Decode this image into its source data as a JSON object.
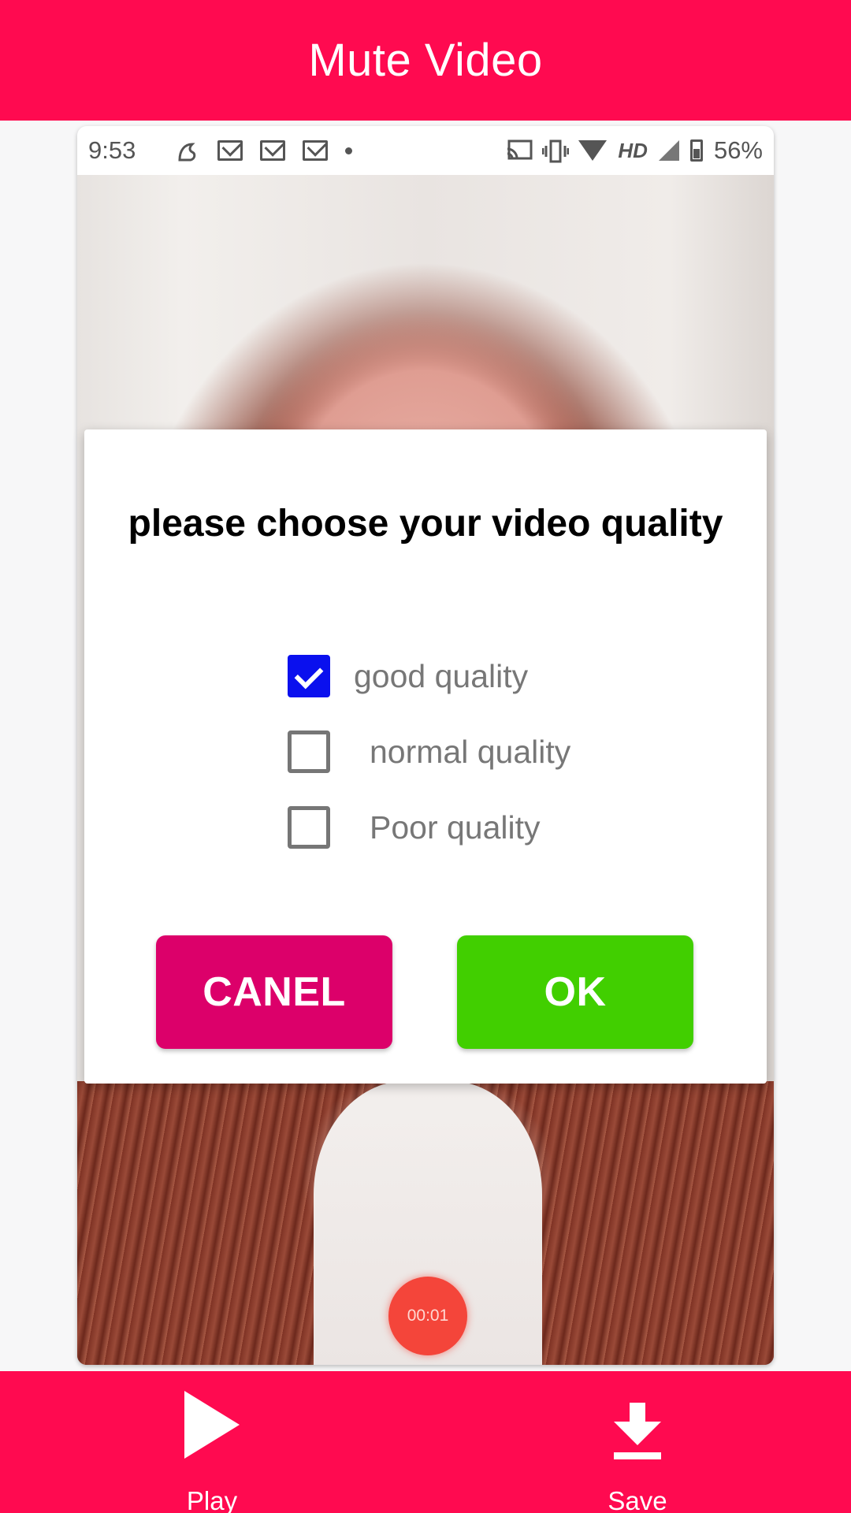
{
  "app_bar": {
    "title": "Mute Video"
  },
  "status_bar": {
    "time": "9:53",
    "network_label": "HD",
    "battery": "56%"
  },
  "video": {
    "timer": "00:01"
  },
  "dialog": {
    "title": "please choose your video quality",
    "options": [
      {
        "label": "good quality",
        "checked": true
      },
      {
        "label": "normal quality",
        "checked": false
      },
      {
        "label": "Poor quality",
        "checked": false
      }
    ],
    "cancel_label": "CANEL",
    "ok_label": "OK"
  },
  "bottom_bar": {
    "play_label": "Play",
    "save_label": "Save"
  },
  "colors": {
    "accent": "#ff0a50",
    "cancel": "#dc006a",
    "ok": "#41cf00",
    "checkbox_checked": "#0a10ee"
  },
  "icons": [
    "play-icon",
    "download-icon",
    "checkbox-checked-icon",
    "checkbox-empty-icon"
  ]
}
